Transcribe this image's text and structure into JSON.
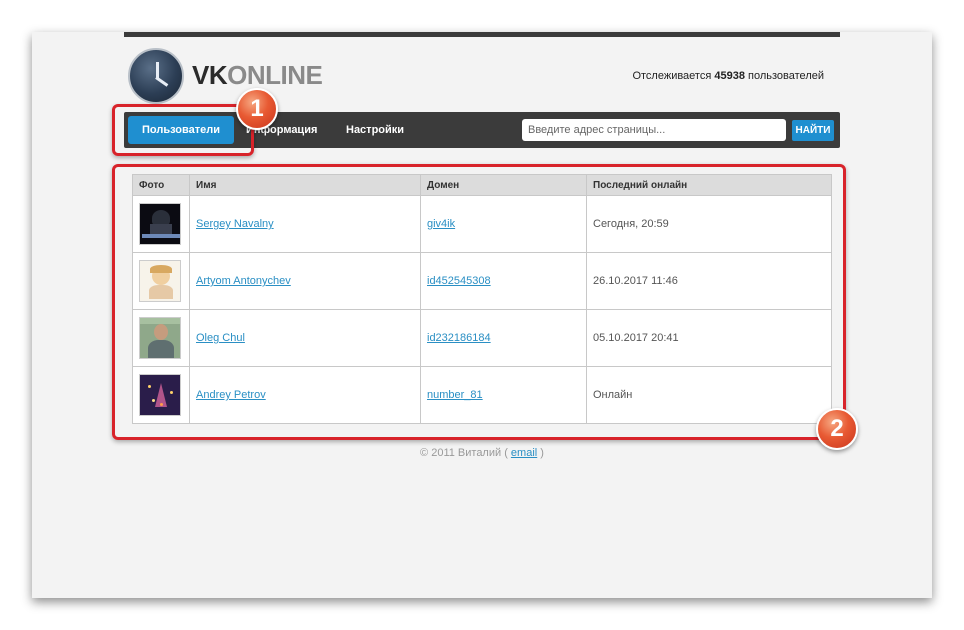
{
  "header": {
    "logo_vk": "VK",
    "logo_online": "ONLINE",
    "tracking_prefix": "Отслеживается",
    "tracking_count": "45938",
    "tracking_suffix": "пользователей"
  },
  "nav": {
    "items": [
      {
        "label": "Пользователи",
        "active": true
      },
      {
        "label": "Информация",
        "active": false
      },
      {
        "label": "Настройки",
        "active": false
      }
    ],
    "search_placeholder": "Введите адрес страницы...",
    "search_button": "НАЙТИ"
  },
  "table": {
    "columns": [
      "Фото",
      "Имя",
      "Домен",
      "Последний онлайн"
    ],
    "rows": [
      {
        "name": "Sergey Navalny",
        "domain": "giv4ik",
        "last_online": "Сегодня, 20:59"
      },
      {
        "name": "Artyom Antonychev",
        "domain": "id452545308",
        "last_online": "26.10.2017 11:46"
      },
      {
        "name": "Oleg Chul",
        "domain": "id232186184",
        "last_online": "05.10.2017 20:41"
      },
      {
        "name": "Andrey Petrov",
        "domain": "number_81",
        "last_online": "Онлайн"
      }
    ]
  },
  "footer": {
    "copyright": "© 2011 Виталий (",
    "email_link": "email",
    "close_paren": ")"
  },
  "annotations": {
    "badge1": "1",
    "badge2": "2",
    "highlight_color": "#d8232a"
  },
  "colors": {
    "accent": "#1f8fd0",
    "navbar": "#3b3b3b",
    "link": "#2a8fc4"
  }
}
